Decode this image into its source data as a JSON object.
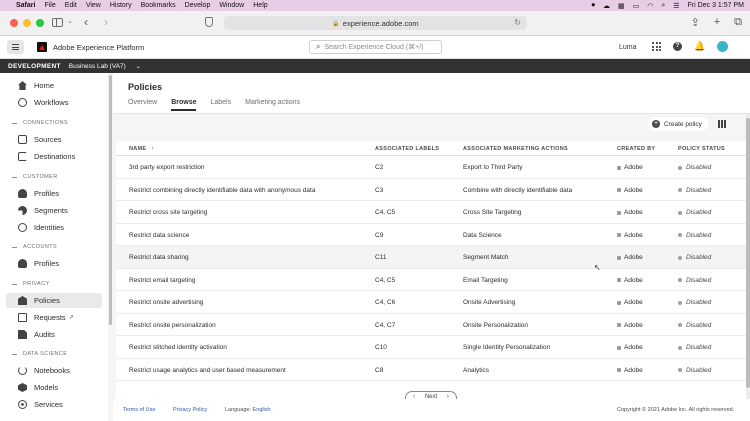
{
  "menubar": {
    "app": "Safari",
    "items": [
      "File",
      "Edit",
      "View",
      "History",
      "Bookmarks",
      "Develop",
      "Window",
      "Help"
    ],
    "datetime": "Fri Dec 3  1:57 PM"
  },
  "browser": {
    "url": "experience.adobe.com"
  },
  "header": {
    "app_name": "Adobe Experience Platform",
    "search_placeholder": "Search Experience Cloud (⌘+/)",
    "org": "Luma"
  },
  "sandbox": {
    "env": "DEVELOPMENT",
    "name": "Business Lab (VA7)"
  },
  "sidebar": {
    "home": "Home",
    "workflows": "Workflows",
    "connections_header": "CONNECTIONS",
    "sources": "Sources",
    "destinations": "Destinations",
    "customer_header": "CUSTOMER",
    "customer_profiles": "Profiles",
    "segments": "Segments",
    "identities": "Identities",
    "accounts_header": "ACCOUNTS",
    "account_profiles": "Profiles",
    "privacy_header": "PRIVACY",
    "policies": "Policies",
    "requests": "Requests",
    "audits": "Audits",
    "data_science_header": "DATA SCIENCE",
    "notebooks": "Notebooks",
    "models": "Models",
    "services": "Services"
  },
  "page": {
    "title": "Policies",
    "tabs": [
      "Overview",
      "Browse",
      "Labels",
      "Marketing actions"
    ],
    "active_tab": "Browse",
    "create_label": "Create policy"
  },
  "table": {
    "headers": {
      "name": "NAME",
      "labels": "ASSOCIATED LABELS",
      "actions": "ASSOCIATED MARKETING ACTIONS",
      "created_by": "CREATED BY",
      "status": "POLICY STATUS"
    },
    "rows": [
      {
        "name": "3rd party export restriction",
        "labels": "C2",
        "action": "Export to Third Party",
        "created_by": "Adobe",
        "status": "Disabled"
      },
      {
        "name": "Restrict combining directly identifiable data with anonymous data",
        "labels": "C3",
        "action": "Combine with directly identifiable data",
        "created_by": "Adobe",
        "status": "Disabled"
      },
      {
        "name": "Restrict cross site targeting",
        "labels": "C4, C5",
        "action": "Cross Site Targeting",
        "created_by": "Adobe",
        "status": "Disabled"
      },
      {
        "name": "Restrict data science",
        "labels": "C9",
        "action": "Data Science",
        "created_by": "Adobe",
        "status": "Disabled"
      },
      {
        "name": "Restrict data sharing",
        "labels": "C11",
        "action": "Segment Match",
        "created_by": "Adobe",
        "status": "Disabled"
      },
      {
        "name": "Restrict email targeting",
        "labels": "C4, C5",
        "action": "Email Targeting",
        "created_by": "Adobe",
        "status": "Disabled"
      },
      {
        "name": "Restrict onsite advertising",
        "labels": "C4, C6",
        "action": "Onsite Advertising",
        "created_by": "Adobe",
        "status": "Disabled"
      },
      {
        "name": "Restrict onsite personalization",
        "labels": "C4, C7",
        "action": "Onsite Personalization",
        "created_by": "Adobe",
        "status": "Disabled"
      },
      {
        "name": "Restrict stitched identity activation",
        "labels": "C10",
        "action": "Single Identity Personalization",
        "created_by": "Adobe",
        "status": "Disabled"
      },
      {
        "name": "Restrict usage analytics and user based measurement",
        "labels": "C8",
        "action": "Analytics",
        "created_by": "Adobe",
        "status": "Disabled"
      }
    ],
    "pager_next": "Next"
  },
  "footer": {
    "terms": "Terms of Use",
    "privacy": "Privacy Policy",
    "language_label": "Language:",
    "language": "English",
    "copyright": "Copyright © 2021 Adobe Inc. All rights reserved."
  }
}
